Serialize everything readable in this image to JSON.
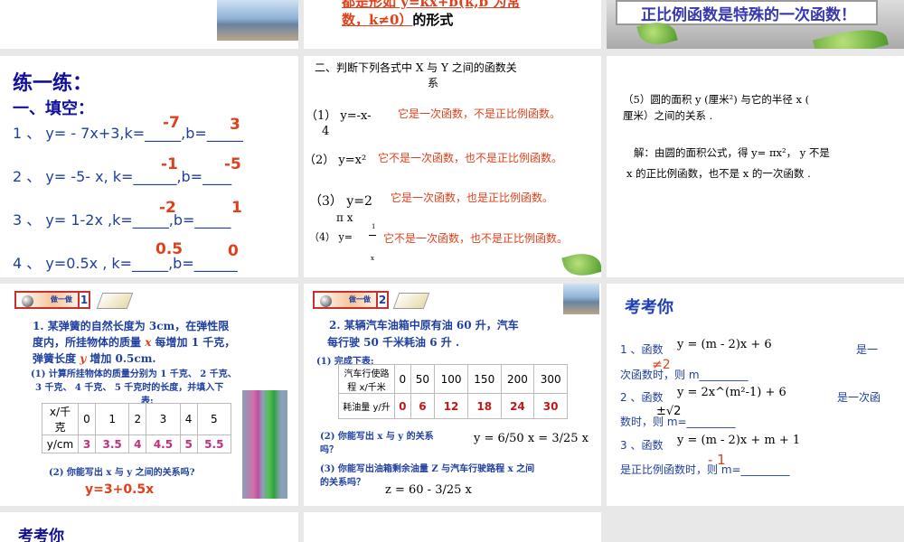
{
  "slides": {
    "s2": {
      "text_red": "都是形如 y=kx+b(k,b 为常数，k≠0）",
      "text_black": "的形式"
    },
    "s3": {
      "board_text": "正比例函数是特殊的一次函数！"
    },
    "s4": {
      "title": "练一练：",
      "subtitle": "一、填空：",
      "rows": [
        {
          "q": "1 、 y=  - 7x+3,k=_____,b=_____",
          "k": "-7",
          "b": "3"
        },
        {
          "q": "2 、 y= -5- x, k=______,b=____",
          "k": "-1",
          "b": "-5"
        },
        {
          "q": "3 、    y= 1-2x    ,k=_____,b=_____",
          "k": "-2",
          "b": "1"
        },
        {
          "q": "4 、    y=0.5x  , k=_____,b=______",
          "k": "0.5",
          "b": "0"
        }
      ]
    },
    "s5": {
      "title1": "二、判断下列各式中 X 与 Y 之间的函数关",
      "title2": "系",
      "items": [
        {
          "expr": "（1） y=-x-",
          "expr2": "4",
          "answer": "它是一次函数，不是正比例函数。"
        },
        {
          "expr": "（2） y=x²",
          "answer": "它不是一次函数，也不是正比例函数。"
        },
        {
          "expr": "（3） y=2",
          "expr2": "π x",
          "answer": "它是一次函数，也是正比例函数。"
        },
        {
          "expr": "（4） y=",
          "num": "1",
          "den": "x",
          "answer": "它不是一次函数，也不是正比例函数。"
        }
      ]
    },
    "s6": {
      "q1": "（5）圆的面积 y (厘米²) 与它的半径 x (",
      "q2": "厘米）之间的关系 .",
      "a1": "解：由圆的面积公式，得 y=  πx²， y 不是",
      "a2": "x 的正比例函数，也不是 x 的一次函数 ."
    },
    "s7": {
      "badge": "做一做",
      "num": "1",
      "p1": "1. 某弹簧的自然长度为 3cm，在弹性限",
      "p2a": "度内，所挂物体的质量 ",
      "p2x": "x",
      "p2b": " 每增加 1 千克，",
      "p3a": "弹簧长度 ",
      "p3y": "y",
      "p3b": " 增加 0.5cm.",
      "q1a": "(1) 计算所挂物体的质量分别为 1 千克、  2 千克、",
      "q1b": "3 千克、  4 千克、  5 千克时的长度，并填入下",
      "q1c": "表:",
      "table": {
        "h1": "x/千克",
        "x": [
          "0",
          "1",
          "2",
          "3",
          "4",
          "5"
        ],
        "h2": "y/cm",
        "y": [
          "3",
          "3.5",
          "4",
          "4.5",
          "5",
          "5.5"
        ]
      },
      "q2": "(2) 你能写出 x 与 y 之间的关系吗?",
      "answer": "y=3+0.5x"
    },
    "s8": {
      "badge": "做一做",
      "num": "2",
      "p1": "2. 某辆汽车油箱中原有油 60 升，汽车",
      "p2": "每行驶 50 千米耗油 6 升 .",
      "q1": "(1)  完成下表:",
      "table": {
        "h1": "汽车行使路程 x/千米",
        "x": [
          "0",
          "50",
          "100",
          "150",
          "200",
          "300"
        ],
        "h2": "耗油量 y/升",
        "y": [
          "0",
          "6",
          "12",
          "18",
          "24",
          "30"
        ]
      },
      "q2a": "(2)  你能写出 x 与 y 的关系",
      "q2b": "吗？",
      "f2": "y = 6/50 x = 3/25 x",
      "q3a": "(3)  你能写出油箱剩余油量 Z 与汽车行驶路程 x 之间",
      "q3b": "的关系吗？",
      "f3": "z = 60 - 3/25 x"
    },
    "s9": {
      "title": "考考你",
      "l1a": "1 、函数",
      "f1": "y = (m - 2)x + 6",
      "l1b": "是一",
      "l1c": "次函数时，则 m_________",
      "a1": "≠2",
      "l2a": "2 、函数",
      "f2": "y = 2x^(m²-1) + 6",
      "l2b": "是一次函",
      "l2c": "数时，则 m=_________",
      "a2": "±√2",
      "l3a": "3 、函数",
      "f3": "y = (m - 2)x + m + 1",
      "l3c": "是正比例函数时，则 m=_________",
      "a3": "- 1"
    },
    "s10": {
      "title": "考考你"
    }
  }
}
